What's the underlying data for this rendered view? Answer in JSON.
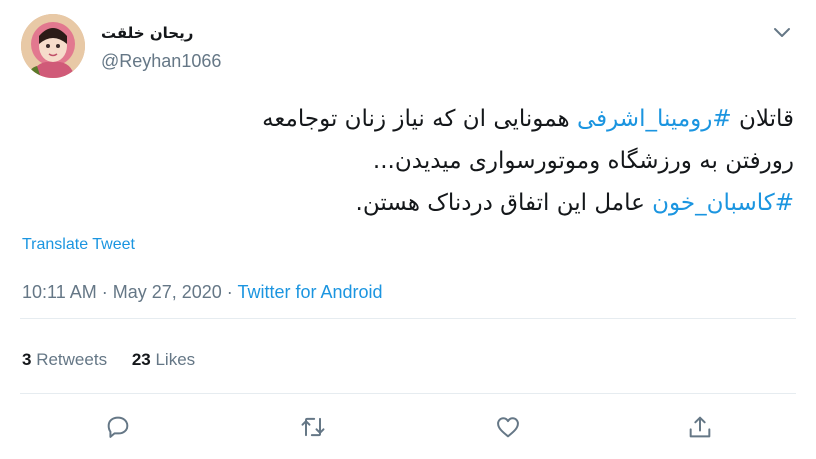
{
  "author": {
    "display_name": "ریحان خلقت",
    "handle": "@Reyhan1066",
    "avatar_icon": "avatar-girl-pink-hijab"
  },
  "tweet": {
    "line1": {
      "before": "قاتلان ",
      "hashtag": "#رومینا_اشرفی",
      "after": " همونایی ان که نیاز زنان توجامعه"
    },
    "line2": "رورفتن به ورزشگاه وموتورسواری میدیدن...",
    "line3": {
      "hashtag": "#کاسبان_خون",
      "after": " عامل این اتفاق دردناک هستن."
    }
  },
  "translate_label": "Translate Tweet",
  "meta": {
    "time": "10:11 AM",
    "separator1": " · ",
    "date": "May 27, 2020",
    "separator2": " · ",
    "source": "Twitter for Android"
  },
  "stats": {
    "retweets_count": "3",
    "retweets_label": "Retweets",
    "likes_count": "23",
    "likes_label": "Likes"
  },
  "actions": [
    "reply-icon",
    "retweet-icon",
    "like-icon",
    "share-icon"
  ],
  "colors": {
    "link": "#1b95e0",
    "secondary_text": "#657786",
    "divider": "#e6ecf0",
    "icon": "#657786"
  }
}
